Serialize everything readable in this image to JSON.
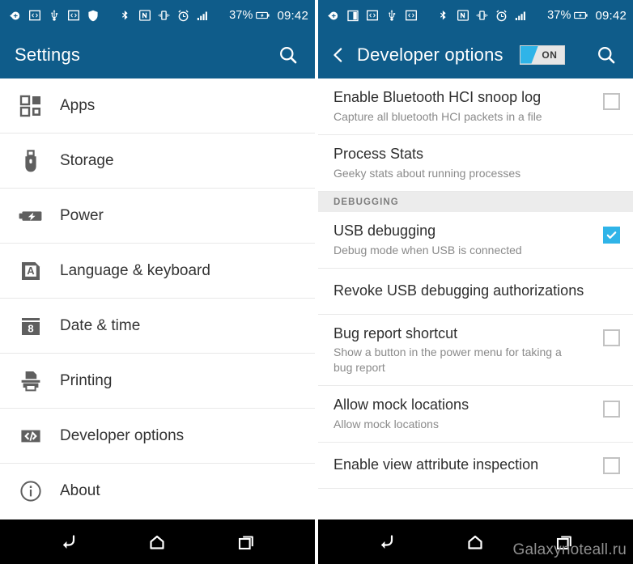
{
  "left": {
    "statusbar": {
      "icons": [
        "arrow-left-badge-icon",
        "code-box-icon",
        "usb-icon",
        "code-box-icon",
        "shield-icon",
        "bluetooth-icon",
        "nfc-icon",
        "vibrate-icon",
        "alarm-icon",
        "signal-bars-icon"
      ],
      "battery_percent": "37%",
      "battery_icon": "battery-charging-icon",
      "clock": "09:42"
    },
    "appbar": {
      "title": "Settings",
      "search_icon": "search-icon"
    },
    "menu": [
      {
        "label": "Apps",
        "icon": "apps-grid-icon"
      },
      {
        "label": "Storage",
        "icon": "usb-drive-icon"
      },
      {
        "label": "Power",
        "icon": "battery-bolt-icon"
      },
      {
        "label": "Language & keyboard",
        "icon": "language-a-icon"
      },
      {
        "label": "Date & time",
        "icon": "calendar-8-icon"
      },
      {
        "label": "Printing",
        "icon": "printer-icon"
      },
      {
        "label": "Developer options",
        "icon": "code-brackets-icon"
      },
      {
        "label": "About",
        "icon": "info-circle-icon"
      }
    ],
    "navbar": {
      "back": "back-arrow-icon",
      "home": "home-icon",
      "recents": "recent-apps-icon"
    }
  },
  "right": {
    "statusbar": {
      "icons": [
        "arrow-left-badge-icon",
        "two-windows-icon",
        "code-box-icon",
        "usb-icon",
        "code-box-icon",
        "bluetooth-icon",
        "nfc-icon",
        "vibrate-icon",
        "alarm-icon",
        "signal-bars-icon"
      ],
      "battery_percent": "37%",
      "battery_icon": "battery-charging-icon",
      "clock": "09:42"
    },
    "appbar": {
      "back_icon": "chevron-left-icon",
      "title": "Developer options",
      "toggle_label": "ON",
      "toggle_state": "on",
      "search_icon": "search-icon"
    },
    "rows": [
      {
        "type": "item",
        "title": "Enable Bluetooth HCI snoop log",
        "subtitle": "Capture all bluetooth HCI packets in a file",
        "checkbox": "unchecked"
      },
      {
        "type": "item",
        "title": "Process Stats",
        "subtitle": "Geeky stats about running processes",
        "checkbox": "none"
      },
      {
        "type": "section",
        "title": "DEBUGGING"
      },
      {
        "type": "item",
        "title": "USB debugging",
        "subtitle": "Debug mode when USB is connected",
        "checkbox": "checked"
      },
      {
        "type": "item",
        "title": "Revoke USB debugging authorizations",
        "subtitle": "",
        "checkbox": "none"
      },
      {
        "type": "item",
        "title": "Bug report shortcut",
        "subtitle": "Show a button in the power menu for taking a bug report",
        "checkbox": "unchecked"
      },
      {
        "type": "item",
        "title": "Allow mock locations",
        "subtitle": "Allow mock locations",
        "checkbox": "unchecked"
      },
      {
        "type": "item",
        "title": "Enable view attribute inspection",
        "subtitle": "",
        "checkbox": "unchecked"
      }
    ],
    "navbar": {
      "back": "back-arrow-icon",
      "home": "home-icon",
      "recents": "recent-apps-icon"
    },
    "watermark": "Galaxynoteall.ru"
  },
  "colors": {
    "appbar_blue": "#0f5c8a",
    "accent_cyan": "#2fb4e8",
    "navbar_black": "#000000",
    "section_bg": "#ececec"
  }
}
